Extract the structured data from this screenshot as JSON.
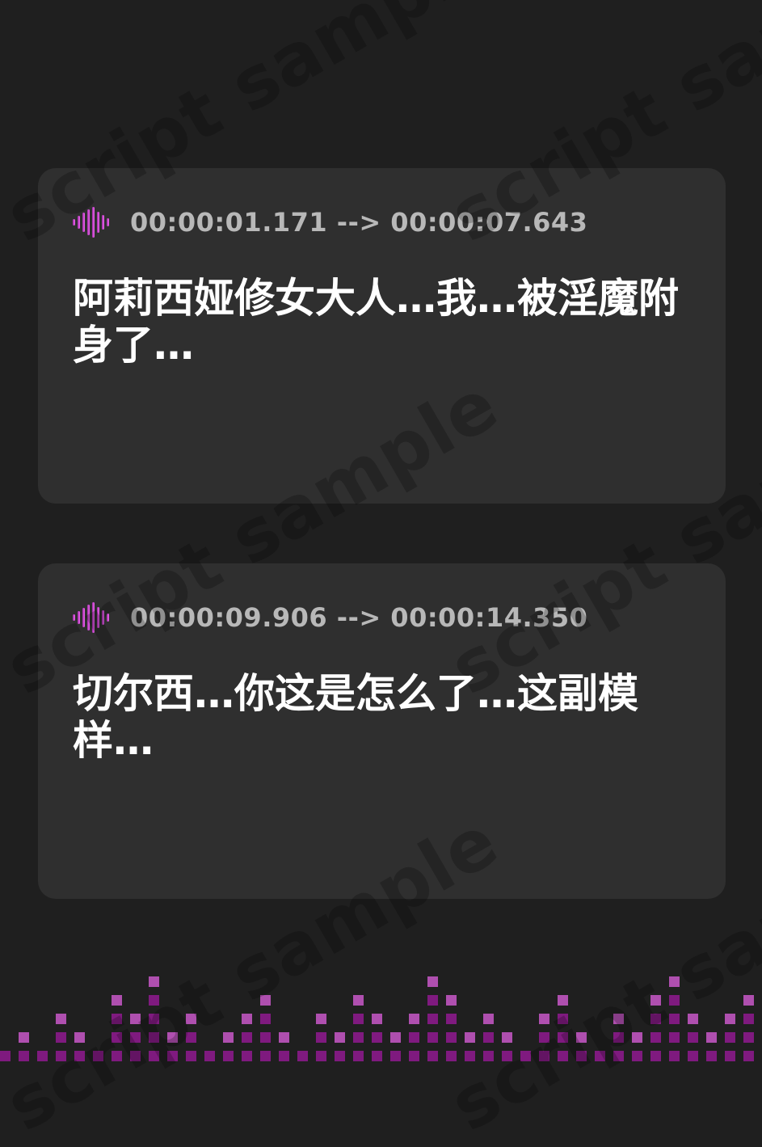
{
  "colors": {
    "background": "#1f1f1f",
    "card": "#2f2f2f",
    "text": "#ffffff",
    "timestamp": "#b8b8b8",
    "accent_light": "#e060e0",
    "accent_dark": "#8a1a8a"
  },
  "watermark": {
    "text": "script sample"
  },
  "cards": [
    {
      "icon": "audio-waveform-icon",
      "timestamp": "00:00:01.171 --> 00:00:07.643",
      "text": "阿莉西娅修女大人…我…被淫魔附身了…"
    },
    {
      "icon": "audio-waveform-icon",
      "timestamp": "00:00:09.906 --> 00:00:14.350",
      "text": "切尔西…你这是怎么了…这副模样…"
    }
  ],
  "footer": {
    "icon": "audio-equalizer-graphic"
  }
}
